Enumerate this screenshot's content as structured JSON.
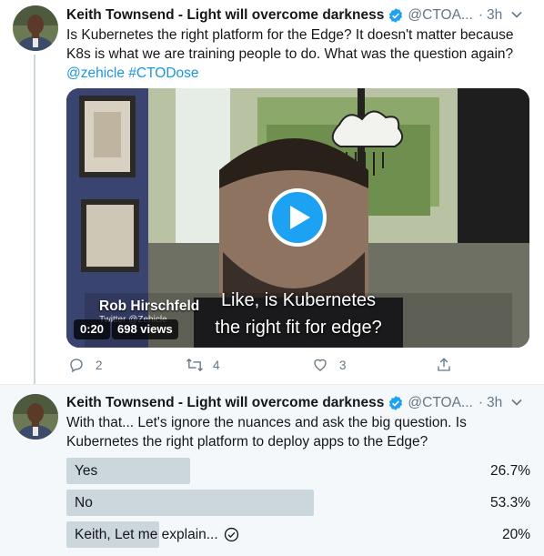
{
  "colors": {
    "link": "#1b95e0",
    "muted": "#657786",
    "verified": "#1da1f2",
    "poll_bar": "#ccd6dd"
  },
  "tweets": [
    {
      "author_name": "Keith Townsend - Light will overcome darkness",
      "handle": "@CTOA...",
      "separator": "·",
      "time": "3h",
      "text": "Is Kubernetes the right platform for the Edge? It doesn't matter because K8s is what we are training people to do. What was the question again?",
      "hashtags": "@zehicle #CTODose",
      "video": {
        "speaker_name": "Rob Hirschfeld",
        "speaker_handle": "Twitter @Zehicle",
        "caption_line1": "Like, is Kubernetes",
        "caption_line2": "the right fit for edge?",
        "duration": "0:20",
        "views": "698 views"
      },
      "actions": {
        "replies": "2",
        "retweets": "4",
        "likes": "3"
      }
    },
    {
      "author_name": "Keith Townsend - Light will overcome darkness",
      "handle": "@CTOA...",
      "separator": "·",
      "time": "3h",
      "text": "With that... Let's ignore the nuances and ask the big question. Is Kubernetes the right platform to deploy apps to the Edge?",
      "poll": {
        "options": [
          {
            "label": "Yes",
            "percent": "26.7%",
            "fraction": 0.267
          },
          {
            "label": "No",
            "percent": "53.3%",
            "fraction": 0.533
          },
          {
            "label": "Keith, Let me explain...",
            "percent": "20%",
            "fraction": 0.2,
            "voted": true
          }
        ]
      }
    }
  ]
}
